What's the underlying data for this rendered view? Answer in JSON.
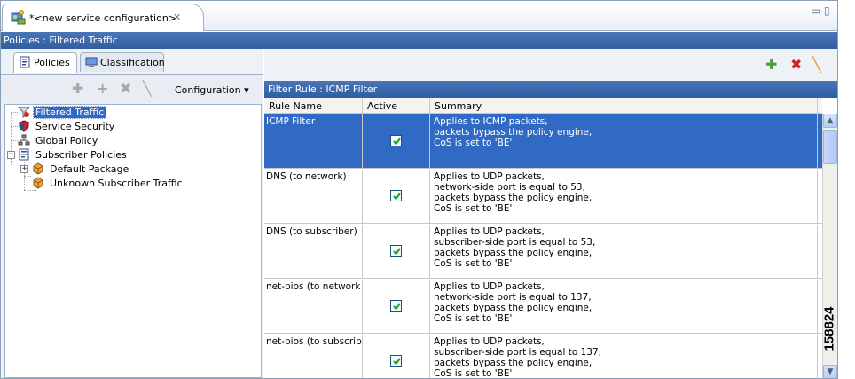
{
  "editor": {
    "tab_label": "*<new service configuration>",
    "close_glyph": "✕",
    "minimize_glyph": "▭",
    "maximize_glyph": "▯",
    "title": "Policies : Filtered Traffic"
  },
  "left": {
    "tabs": [
      {
        "label": "Policies",
        "icon": "policy-icon"
      },
      {
        "label": "Classification",
        "icon": "classification-icon"
      }
    ],
    "toolbar": {
      "configuration_label": "Configuration",
      "dropdown_glyph": "▾"
    },
    "tree": [
      {
        "label": "Filtered Traffic",
        "icon": "filter-icon",
        "selected": true
      },
      {
        "label": "Service Security",
        "icon": "shield-icon"
      },
      {
        "label": "Global Policy",
        "icon": "network-icon"
      },
      {
        "label": "Subscriber Policies",
        "icon": "policy-icon",
        "expanded": true
      },
      {
        "label": "Default Package",
        "icon": "package-icon",
        "expandable": true
      },
      {
        "label": "Unknown Subscriber Traffic",
        "icon": "package-icon"
      }
    ]
  },
  "right": {
    "section_title": "Filter Rule : ICMP Filter",
    "columns": [
      "Rule Name",
      "Active",
      "Summary"
    ],
    "rows": [
      {
        "name": "ICMP Filter",
        "active": true,
        "selected": true,
        "summary": [
          "Applies to ICMP packets,",
          "packets bypass the policy engine,",
          "CoS is set to 'BE'"
        ]
      },
      {
        "name": "DNS (to network)",
        "active": true,
        "summary": [
          "Applies to UDP packets,",
          "network-side port is equal to 53,",
          "packets bypass the policy engine,",
          "CoS is set to 'BE'"
        ]
      },
      {
        "name": "DNS (to subscriber)",
        "active": true,
        "summary": [
          "Applies to UDP packets,",
          "subscriber-side port is equal to 53,",
          "packets bypass the policy engine,",
          "CoS is set to 'BE'"
        ]
      },
      {
        "name": "net-bios (to network",
        "active": true,
        "summary": [
          "Applies to UDP packets,",
          "network-side port is equal to 137,",
          "packets bypass the policy engine,",
          "CoS is set to 'BE'"
        ]
      },
      {
        "name": "net-bios (to subscrib",
        "active": true,
        "summary": [
          "Applies to UDP packets,",
          "subscriber-side port is equal to 137,",
          "packets bypass the policy engine,",
          "CoS is set to 'BE'"
        ]
      }
    ]
  },
  "figure_id": "158824",
  "colors": {
    "header_blue": "#2f5ea4",
    "selection_blue": "#316ac5",
    "add_green": "#4aa03a",
    "delete_red": "#d32222",
    "edit_orange": "#e0a000"
  }
}
